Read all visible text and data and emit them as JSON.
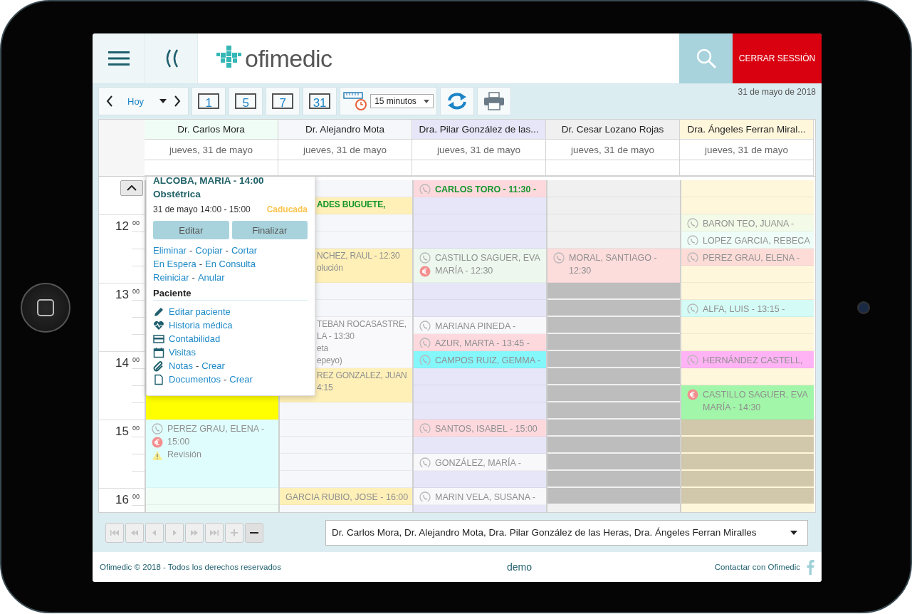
{
  "header": {
    "logo": "ofimedic",
    "logout": "CERRAR SESSIÓN"
  },
  "toolbar": {
    "today": "Hoy",
    "views": [
      "1",
      "5",
      "7",
      "31"
    ],
    "interval": "15 minutos",
    "date": "31 de mayo de 2018"
  },
  "hours": [
    {
      "hour": "12",
      "minutes": "00"
    },
    {
      "hour": "13",
      "minutes": "00"
    },
    {
      "hour": "14",
      "minutes": "00"
    },
    {
      "hour": "15",
      "minutes": "00"
    },
    {
      "hour": "16",
      "minutes": "00"
    }
  ],
  "columns": [
    {
      "name": "Dr. Carlos Mora",
      "date": "jueves, 31 de mayo",
      "color": "#effdf6",
      "slots": [
        {
          "kind": "free"
        },
        {
          "kind": "free"
        },
        {
          "kind": "free"
        },
        {
          "kind": "free"
        },
        {
          "kind": "free"
        },
        {
          "kind": "free"
        },
        {
          "kind": "free"
        },
        {
          "kind": "free"
        },
        {
          "kind": "free"
        },
        {
          "kind": "free"
        },
        {
          "kind": "event",
          "color": "#ffff00"
        },
        {
          "kind": "cont"
        },
        {
          "kind": "cont"
        },
        {
          "kind": "cont"
        },
        {
          "kind": "event",
          "color": "#e0fdfd",
          "highlighted": false,
          "phone": true,
          "payment": true,
          "alert": true,
          "lines": [
            "PEREZ GRAU, ELENA -",
            "15:00",
            "Revisión"
          ]
        },
        {
          "kind": "cont"
        },
        {
          "kind": "cont"
        },
        {
          "kind": "cont"
        },
        {
          "kind": "free"
        }
      ]
    },
    {
      "name": "Dr. Alejandro Mota",
      "date": "jueves, 31 de mayo",
      "color": "#f6f7fb",
      "slots": [
        {
          "kind": "free"
        },
        {
          "kind": "partial",
          "color": "#fff0b8",
          "highlighted": true,
          "lines": [
            "ADES BUGUETE,"
          ]
        },
        {
          "kind": "free"
        },
        {
          "kind": "free"
        },
        {
          "kind": "partial",
          "color": "#fff0b8",
          "highlighted": false,
          "lines": [
            "NCHEZ, RAUL - 12:30",
            "olución"
          ]
        },
        {
          "kind": "cont"
        },
        {
          "kind": "free"
        },
        {
          "kind": "free"
        },
        {
          "kind": "partial",
          "color": "#f9f9fb",
          "highlighted": false,
          "lines": [
            "TEBAN ROCASASTRE,",
            "LA - 13:30",
            "eta",
            "epeyo)"
          ]
        },
        {
          "kind": "cont"
        },
        {
          "kind": "cont"
        },
        {
          "kind": "partial",
          "color": "#fff0b8",
          "highlighted": false,
          "lines": [
            "REZ GONZALEZ, JUAN",
            "4:15"
          ]
        },
        {
          "kind": "cont"
        },
        {
          "kind": "free"
        },
        {
          "kind": "free"
        },
        {
          "kind": "free"
        },
        {
          "kind": "free"
        },
        {
          "kind": "free"
        },
        {
          "kind": "event",
          "color": "#fff0b8",
          "highlighted": false,
          "phone": false,
          "payment": false,
          "alert": false,
          "lines": [
            "GARCIA RUBIO, JOSE - 16:00"
          ]
        }
      ]
    },
    {
      "name": "Dra. Pilar González de las...",
      "date": "jueves, 31 de mayo",
      "color": "#e6e6f8",
      "slots": [
        {
          "kind": "event",
          "color": "#fdd9de",
          "highlighted": true,
          "phone": true,
          "payment": false,
          "alert": false,
          "lines": [
            "CARLOS TORO - 11:30 -"
          ]
        },
        {
          "kind": "free"
        },
        {
          "kind": "free"
        },
        {
          "kind": "free"
        },
        {
          "kind": "event",
          "color": "#edf7ee",
          "highlighted": false,
          "phone": true,
          "payment": true,
          "alert": false,
          "lines": [
            "CASTILLO SAGUER, EVA",
            "MARÍA - 12:30"
          ]
        },
        {
          "kind": "cont"
        },
        {
          "kind": "free"
        },
        {
          "kind": "free"
        },
        {
          "kind": "event",
          "color": "#f8f8fb",
          "highlighted": false,
          "phone": true,
          "payment": false,
          "alert": false,
          "lines": [
            "MARIANA PINEDA -"
          ]
        },
        {
          "kind": "event",
          "color": "#fdd9de",
          "highlighted": false,
          "phone": true,
          "payment": false,
          "alert": false,
          "lines": [
            "AZUR, MARTA - 13:45 -"
          ]
        },
        {
          "kind": "event",
          "color": "#84f7fb",
          "highlighted": false,
          "phone": true,
          "payment": false,
          "alert": false,
          "lines": [
            "CAMPOS RUIZ, GEMMA -"
          ]
        },
        {
          "kind": "free"
        },
        {
          "kind": "free"
        },
        {
          "kind": "free"
        },
        {
          "kind": "event",
          "color": "#fdd9de",
          "highlighted": false,
          "phone": true,
          "payment": false,
          "alert": false,
          "lines": [
            "SANTOS, ISABEL - 15:00"
          ]
        },
        {
          "kind": "free"
        },
        {
          "kind": "event",
          "color": "#f8f8fb",
          "highlighted": false,
          "phone": true,
          "payment": false,
          "alert": false,
          "lines": [
            "GONZÁLEZ, MARÍA -"
          ]
        },
        {
          "kind": "free"
        },
        {
          "kind": "event",
          "color": "#f8f8fb",
          "highlighted": false,
          "phone": true,
          "payment": false,
          "alert": false,
          "lines": [
            "MARIN VELA, SUSANA -"
          ]
        }
      ]
    },
    {
      "name": "Dr. Cesar Lozano Rojas",
      "date": "jueves, 31 de mayo",
      "color": "#f0f0f0",
      "slots": [
        {
          "kind": "free"
        },
        {
          "kind": "free"
        },
        {
          "kind": "free"
        },
        {
          "kind": "free"
        },
        {
          "kind": "event",
          "color": "#fddcdc",
          "highlighted": false,
          "phone": true,
          "payment": false,
          "alert": false,
          "lines": [
            "MORAL, SANTIAGO -",
            "12:30"
          ]
        },
        {
          "kind": "cont"
        },
        {
          "kind": "blocked",
          "color": "#bdbdbd"
        },
        {
          "kind": "blocked",
          "color": "#bdbdbd"
        },
        {
          "kind": "blocked",
          "color": "#bdbdbd"
        },
        {
          "kind": "blocked",
          "color": "#bdbdbd"
        },
        {
          "kind": "blocked",
          "color": "#bdbdbd"
        },
        {
          "kind": "blocked",
          "color": "#bdbdbd"
        },
        {
          "kind": "blocked",
          "color": "#bdbdbd"
        },
        {
          "kind": "blocked",
          "color": "#bdbdbd"
        },
        {
          "kind": "blocked",
          "color": "#bdbdbd"
        },
        {
          "kind": "blocked",
          "color": "#bdbdbd"
        },
        {
          "kind": "blocked",
          "color": "#bdbdbd"
        },
        {
          "kind": "blocked",
          "color": "#bdbdbd"
        },
        {
          "kind": "blocked",
          "color": "#bdbdbd"
        }
      ]
    },
    {
      "name": "Dra. Ángeles Ferran Miral...",
      "date": "jueves, 31 de mayo",
      "color": "#fff7dc",
      "slots": [
        {
          "kind": "free"
        },
        {
          "kind": "free"
        },
        {
          "kind": "event",
          "color": "#f3fbe8",
          "highlighted": false,
          "phone": true,
          "payment": false,
          "alert": false,
          "lines": [
            "BARON TEO, JUANA -"
          ]
        },
        {
          "kind": "event",
          "color": "#effdf8",
          "highlighted": false,
          "phone": true,
          "payment": false,
          "alert": false,
          "lines": [
            "LOPEZ GARCIA, REBECA"
          ]
        },
        {
          "kind": "event",
          "color": "#fddcd8",
          "highlighted": false,
          "phone": true,
          "payment": false,
          "alert": false,
          "lines": [
            "PEREZ GRAU, ELENA -"
          ]
        },
        {
          "kind": "free"
        },
        {
          "kind": "free"
        },
        {
          "kind": "event",
          "color": "#d4fbf5",
          "highlighted": false,
          "phone": true,
          "payment": false,
          "alert": false,
          "lines": [
            "ALFA, LUIS - 13:15 -"
          ]
        },
        {
          "kind": "free"
        },
        {
          "kind": "free"
        },
        {
          "kind": "event",
          "color": "#ffb3f5",
          "highlighted": false,
          "phone": true,
          "payment": false,
          "alert": false,
          "lines": [
            "HERNÁNDEZ CASTELL,"
          ]
        },
        {
          "kind": "free"
        },
        {
          "kind": "event",
          "color": "#a2f6a9",
          "highlighted": false,
          "phone": false,
          "payment": true,
          "alert": false,
          "lines": [
            "CASTILLO SAGUER, EVA",
            "MARÍA - 14:30"
          ]
        },
        {
          "kind": "cont"
        },
        {
          "kind": "blocked",
          "color": "#d1c7ab"
        },
        {
          "kind": "blocked",
          "color": "#d1c7ab"
        },
        {
          "kind": "blocked",
          "color": "#d1c7ab"
        },
        {
          "kind": "blocked",
          "color": "#d1c7ab"
        },
        {
          "kind": "blocked",
          "color": "#d1c7ab"
        }
      ]
    }
  ],
  "popup": {
    "title": "ALCOBA, MARIA - 14:00",
    "subtitle": "Obstétrica",
    "time": "31 de mayo 14:00 - 15:00",
    "status": "Caducada",
    "buttons": [
      "Editar",
      "Finalizar"
    ],
    "separator": "-",
    "actions": [
      [
        "Eliminar",
        "Copiar",
        "Cortar"
      ],
      [
        "En Espera",
        "En Consulta"
      ],
      [
        "Reiniciar",
        "Anular"
      ]
    ],
    "section": "Paciente",
    "patient_links": [
      {
        "kind": "edit",
        "label": "Editar paciente"
      },
      {
        "kind": "history",
        "label": "Historia médica"
      },
      {
        "kind": "accounting",
        "label": "Contabilidad"
      },
      {
        "kind": "visits",
        "label": "Visitas"
      },
      {
        "kind": "notes",
        "label": "Notas",
        "extra": "Crear"
      },
      {
        "kind": "documents",
        "label": "Documentos",
        "extra": "Crear"
      }
    ]
  },
  "pager": [
    {
      "kind": "first",
      "disabled": true
    },
    {
      "kind": "rewind",
      "disabled": true
    },
    {
      "kind": "prev",
      "disabled": true
    },
    {
      "kind": "next",
      "disabled": true
    },
    {
      "kind": "forward",
      "disabled": true
    },
    {
      "kind": "last",
      "disabled": true
    },
    {
      "kind": "add",
      "disabled": true
    },
    {
      "kind": "remove",
      "disabled": false
    }
  ],
  "doctor_select": "Dr. Carlos Mora, Dr. Alejandro Mota, Dra. Pilar González de las Heras, Dra. Ángeles Ferran Miralles",
  "footer": {
    "copyright": "Ofimedic © 2018 - Todos los derechos reservados",
    "user": "demo",
    "contact": "Contactar con Ofimedic"
  }
}
